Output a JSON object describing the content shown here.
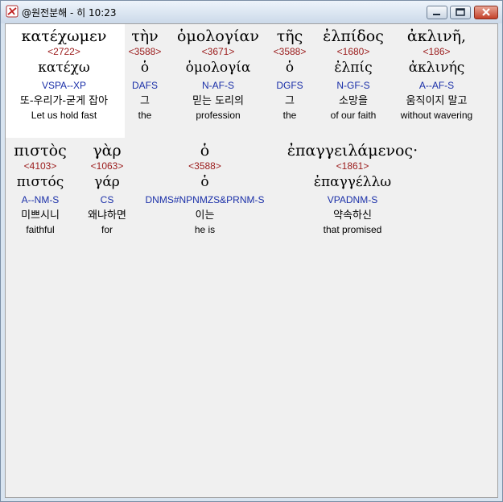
{
  "window": {
    "title": "@원전분해 - 히 10:23"
  },
  "rows": [
    {
      "words": [
        {
          "greek": "κατέχωμεν",
          "strong": "<2722>",
          "lemma": "κατέχω",
          "morph": "VSPA--XP",
          "korean": "또-우리가-굳게 잡아",
          "english": "Let us hold fast"
        },
        {
          "greek": "τὴν",
          "strong": "<3588>",
          "lemma": "ὁ",
          "morph": "DAFS",
          "korean": "그",
          "english": "the"
        },
        {
          "greek": "ὁμολογίαν",
          "strong": "<3671>",
          "lemma": "ὁμολογία",
          "morph": "N-AF-S",
          "korean": "믿는 도리의",
          "english": "profession"
        },
        {
          "greek": "τῆς",
          "strong": "<3588>",
          "lemma": "ὁ",
          "morph": "DGFS",
          "korean": "그",
          "english": "the"
        },
        {
          "greek": "ἐλπίδος",
          "strong": "<1680>",
          "lemma": "ἐλπίς",
          "morph": "N-GF-S",
          "korean": "소망을",
          "english": "of our faith"
        },
        {
          "greek": "ἀκλινῆ,",
          "strong": "<186>",
          "lemma": "ἀκλινής",
          "morph": "A--AF-S",
          "korean": "움직이지 말고",
          "english": "without wavering"
        }
      ]
    },
    {
      "words": [
        {
          "greek": "πιστὸς",
          "strong": "<4103>",
          "lemma": "πιστός",
          "morph": "A--NM-S",
          "korean": "미쁘시니",
          "english": "faithful"
        },
        {
          "greek": "γὰρ",
          "strong": "<1063>",
          "lemma": "γάρ",
          "morph": "CS",
          "korean": "왜냐하면",
          "english": "for"
        },
        {
          "greek": "ὁ",
          "strong": "<3588>",
          "lemma": "ὁ",
          "morph": "DNMS#NPNMZS&PRNM-S",
          "korean": "이는",
          "english": "he is"
        },
        {
          "greek": "ἐπαγγειλάμενος·",
          "strong": "<1861>",
          "lemma": "ἐπαγγέλλω",
          "morph": "VPADNM-S",
          "korean": "약속하신",
          "english": "that promised"
        }
      ]
    }
  ]
}
